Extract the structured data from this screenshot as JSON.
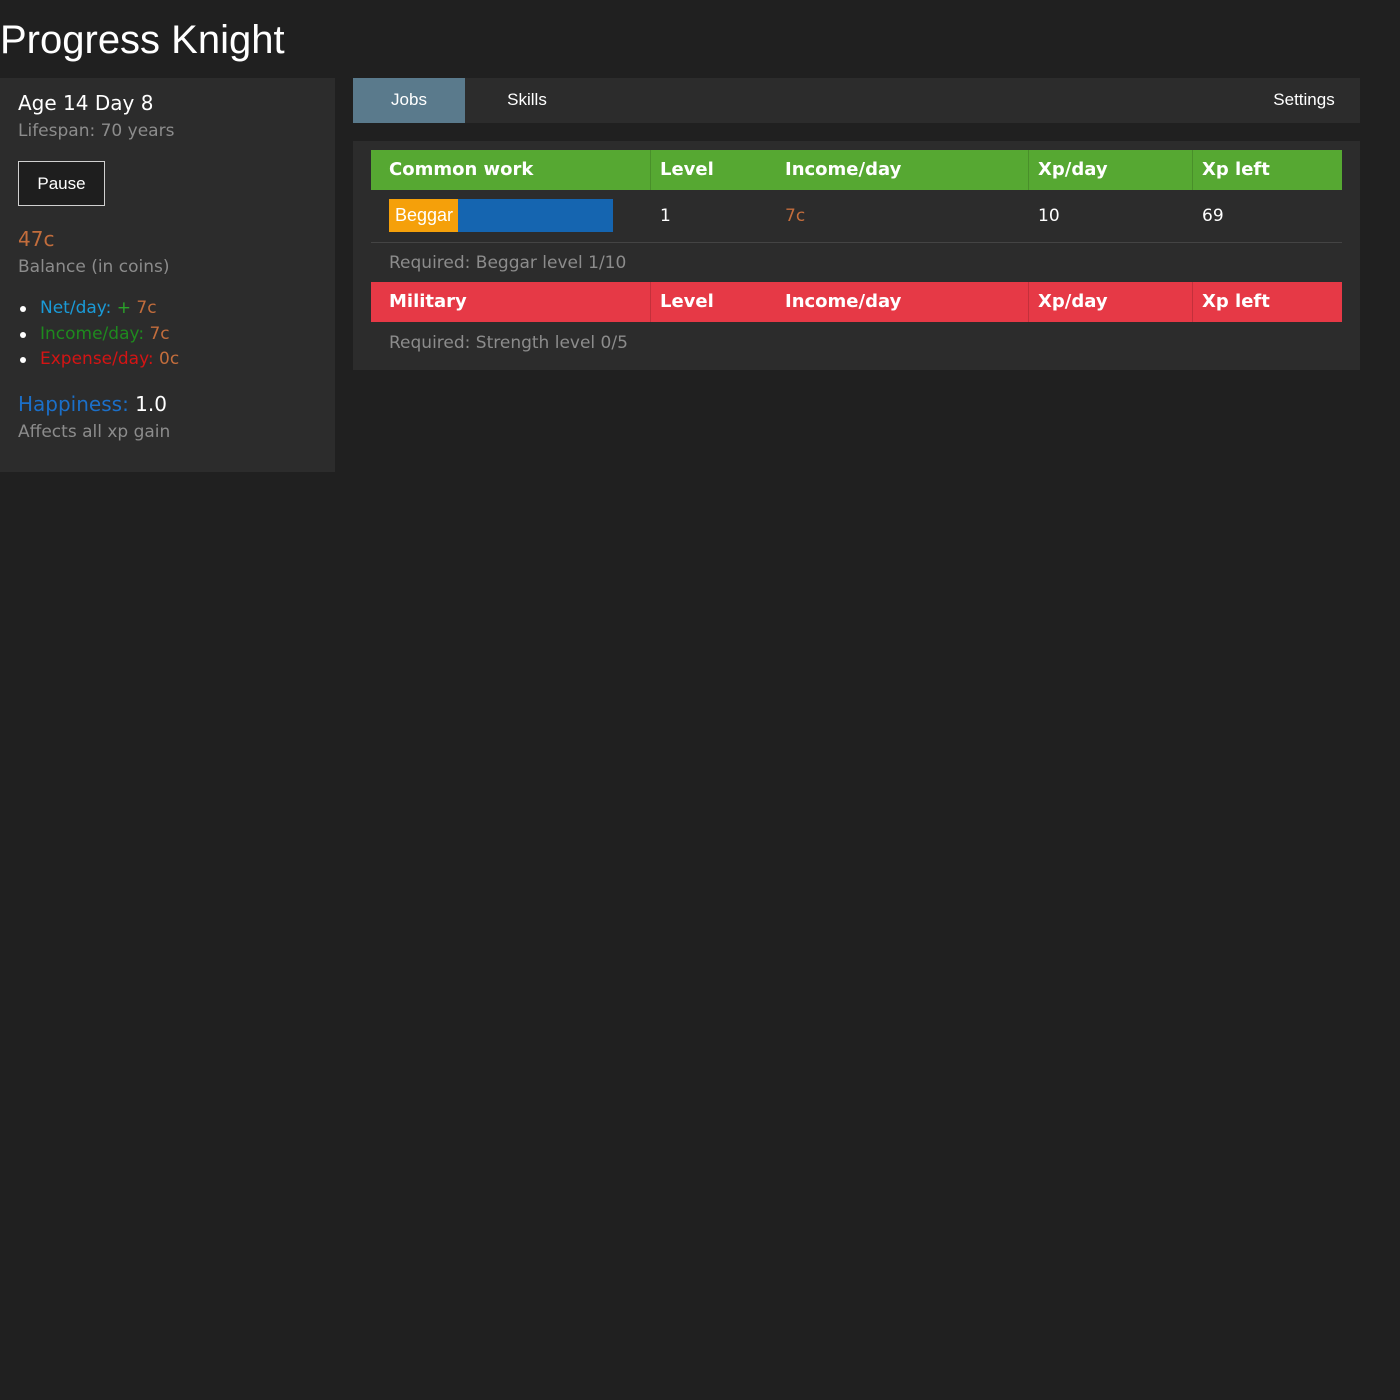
{
  "app": {
    "title": "Progress Knight"
  },
  "sidebar": {
    "age": "Age 14 Day 8",
    "lifespan": "Lifespan: 70 years",
    "pause_label": "Pause",
    "balance": "47c",
    "balance_label": "Balance (in coins)",
    "net_label": "Net/day: ",
    "net_sign": "+ ",
    "net_value": "7c",
    "income_label": "Income/day: ",
    "income_value": "7c",
    "expense_label": "Expense/day: ",
    "expense_value": "0c",
    "happiness_label": "Happiness: ",
    "happiness_value": "1.0",
    "happiness_note": "Affects all xp gain"
  },
  "tabs": {
    "jobs": "Jobs",
    "skills": "Skills",
    "settings": "Settings"
  },
  "jobs": {
    "columns": [
      "Level",
      "Income/day",
      "Xp/day",
      "Xp left"
    ],
    "categories": [
      {
        "name": "Common work",
        "color": "#56a832",
        "rows": [
          {
            "name": "Beggar",
            "level": "1",
            "income": "7c",
            "xp_per_day": "10",
            "xp_left": "69",
            "progress": 0.31
          }
        ],
        "requirement": "Required: Beggar level 1/10"
      },
      {
        "name": "Military",
        "color": "#e63946",
        "rows": [],
        "requirement": "Required: Strength level 0/5"
      }
    ]
  },
  "colors": {
    "background": "#202020",
    "panel": "#2c2c2c",
    "coin": "#c36d3c",
    "progress_fill": "#f5a00a",
    "progress_track": "#1565b0",
    "tab_active": "#5a7a8c"
  }
}
